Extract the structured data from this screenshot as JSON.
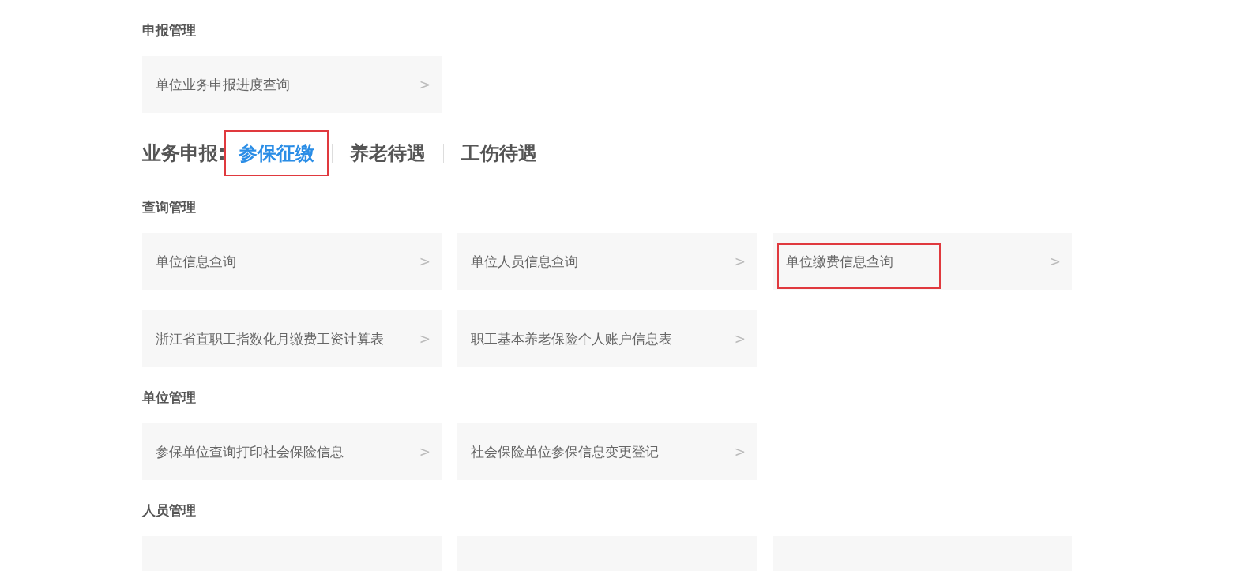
{
  "sections_top": [
    {
      "heading": "申报管理",
      "cards": [
        {
          "label": "单位业务申报进度查询",
          "arrow": ">",
          "highlighted": false
        }
      ]
    }
  ],
  "business_tabs": {
    "label": "业务申报:",
    "tabs": [
      {
        "label": "参保征缴",
        "selected": true,
        "highlighted": true
      },
      {
        "label": "养老待遇",
        "selected": false,
        "highlighted": false
      },
      {
        "label": "工伤待遇",
        "selected": false,
        "highlighted": false
      }
    ]
  },
  "sections": [
    {
      "heading": "查询管理",
      "cards": [
        {
          "label": "单位信息查询",
          "arrow": ">",
          "highlighted": false
        },
        {
          "label": "单位人员信息查询",
          "arrow": ">",
          "highlighted": false
        },
        {
          "label": "单位缴费信息查询",
          "arrow": ">",
          "highlighted": true
        },
        {
          "label": "浙江省直职工指数化月缴费工资计算表",
          "arrow": ">",
          "highlighted": false
        },
        {
          "label": "职工基本养老保险个人账户信息表",
          "arrow": ">",
          "highlighted": false
        }
      ]
    },
    {
      "heading": "单位管理",
      "cards": [
        {
          "label": "参保单位查询打印社会保险信息",
          "arrow": ">",
          "highlighted": false
        },
        {
          "label": "社会保险单位参保信息变更登记",
          "arrow": ">",
          "highlighted": false
        }
      ]
    },
    {
      "heading": "人员管理",
      "cards": [
        {
          "highlighted": false
        },
        {
          "highlighted": false
        },
        {
          "highlighted": false
        }
      ]
    }
  ]
}
